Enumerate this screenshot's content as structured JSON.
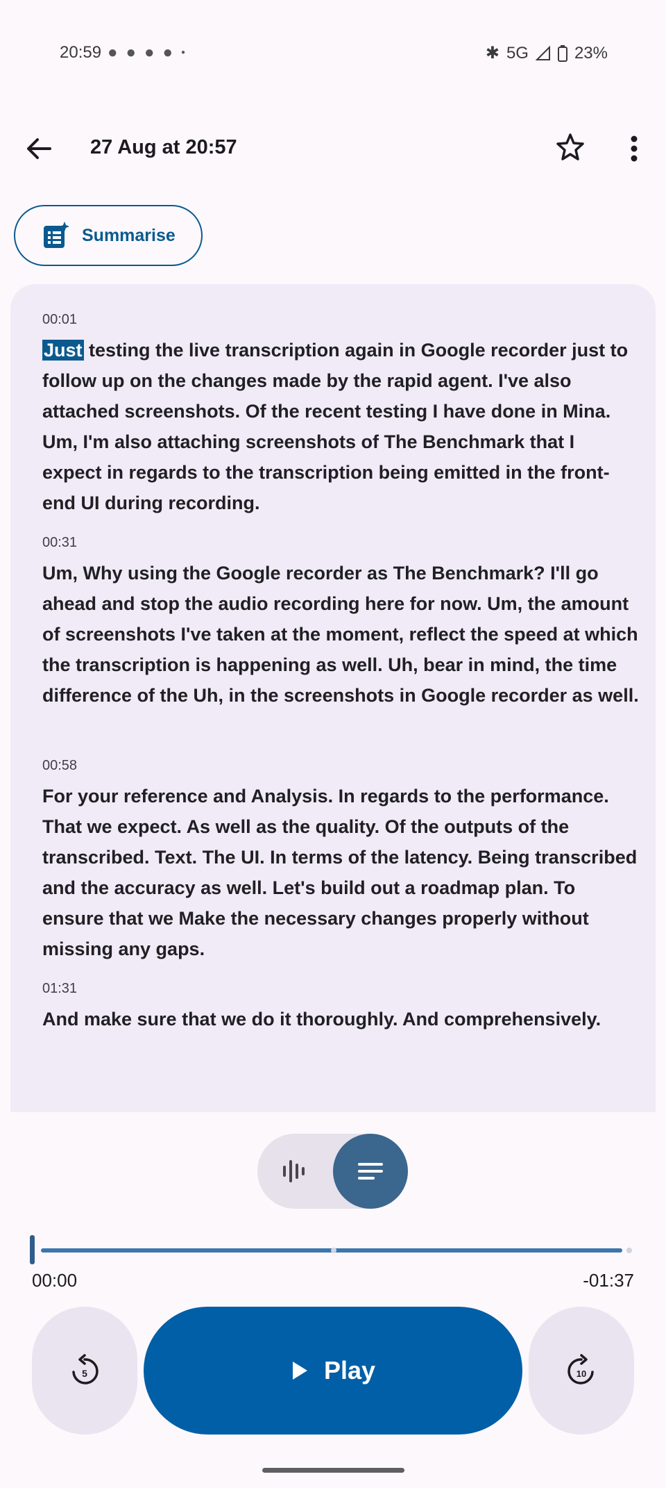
{
  "status_bar": {
    "time": "20:59",
    "notification_icons": [
      "snapchat-icon",
      "message-icon",
      "snapchat-icon",
      "snapchat-icon",
      "dot-icon"
    ],
    "network": "5G",
    "battery": "23%"
  },
  "header": {
    "title": "27 Aug at 20:57",
    "back_icon": "arrow-back-icon",
    "star_icon": "star-outline-icon",
    "more_icon": "more-vert-icon"
  },
  "summarise": {
    "label": "Summarise",
    "icon": "summarise-icon"
  },
  "transcript": {
    "segments": [
      {
        "timestamp": "00:01",
        "highlighted_word": "Just",
        "text": " testing the live transcription again in Google recorder just to follow up on the changes made by the rapid agent. I've also attached screenshots. Of the recent testing I have done in Mina. Um, I'm also attaching screenshots of The Benchmark that I expect in regards to the transcription being emitted in the front-end UI during recording."
      },
      {
        "timestamp": "00:31",
        "text": "Um, Why using the Google recorder as The Benchmark? I'll go ahead and stop the audio recording here for now. Um, the amount of screenshots I've taken at the moment, reflect the speed at which the transcription is happening as well. Uh, bear in mind, the time difference of the Uh, in the screenshots in Google recorder as well."
      },
      {
        "timestamp": "00:58",
        "text": "For your reference and Analysis. In regards to the performance. That we expect. As well as the quality. Of the outputs of the transcribed. Text. The UI. In terms of the latency. Being transcribed and the accuracy as well. Let's build out a roadmap plan. To ensure that we Make the necessary changes properly without missing any gaps."
      },
      {
        "timestamp": "01:31",
        "text": "And make sure that we do it thoroughly. And comprehensively."
      }
    ]
  },
  "view_toggle": {
    "waveform_icon": "waveform-icon",
    "transcript_icon": "transcript-lines-icon",
    "selected": "transcript"
  },
  "player": {
    "elapsed": "00:00",
    "remaining": "-01:37",
    "progress": 0.0,
    "play_label": "Play",
    "rewind_icon": "replay-5-icon",
    "forward_icon": "forward-10-icon",
    "accent_color": "#005fa6"
  }
}
